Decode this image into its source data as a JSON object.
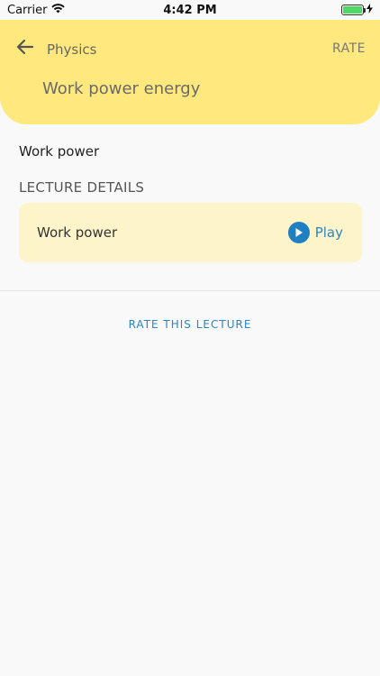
{
  "status_bar": {
    "carrier": "Carrier",
    "time": "4:42 PM"
  },
  "header": {
    "section": "Physics",
    "rate_label": "RATE",
    "title": "Work power energy"
  },
  "lecture": {
    "name": "Work power",
    "details_heading": "LECTURE DETAILS",
    "card": {
      "title": "Work power",
      "play_label": "Play"
    }
  },
  "footer": {
    "rate_lecture_label": "RATE THIS LECTURE"
  },
  "colors": {
    "header_bg": "#ffe97e",
    "card_bg": "#fdf4c9",
    "accent": "#2b86c5",
    "battery": "#4cd964"
  }
}
